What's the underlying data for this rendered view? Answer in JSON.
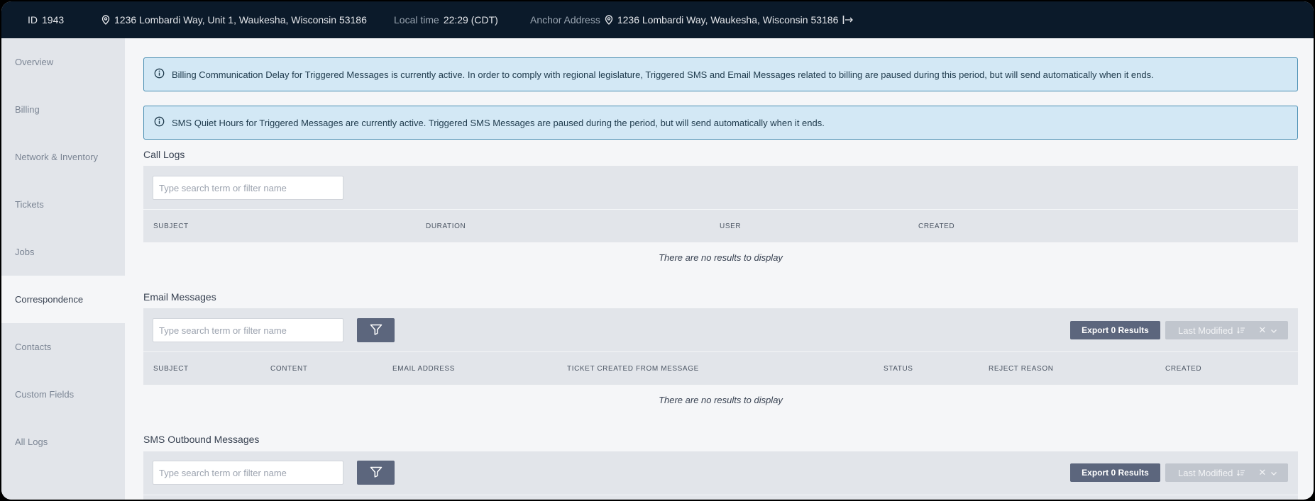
{
  "topbar": {
    "id_label": "ID",
    "id_value": "1943",
    "address": "1236 Lombardi Way, Unit 1, Waukesha, Wisconsin 53186",
    "local_time_label": "Local time",
    "local_time_value": "22:29 (CDT)",
    "anchor_label": "Anchor Address",
    "anchor_address": "1236 Lombardi Way, Waukesha, Wisconsin 53186"
  },
  "sidebar": {
    "items": [
      {
        "label": "Overview"
      },
      {
        "label": "Billing"
      },
      {
        "label": "Network & Inventory"
      },
      {
        "label": "Tickets"
      },
      {
        "label": "Jobs"
      },
      {
        "label": "Correspondence",
        "active": true
      },
      {
        "label": "Contacts"
      },
      {
        "label": "Custom Fields"
      },
      {
        "label": "All Logs"
      }
    ]
  },
  "alerts": [
    {
      "text": "Billing Communication Delay for Triggered Messages is currently active. In order to comply with regional legislature, Triggered SMS and Email Messages related to billing are paused during this period, but will send automatically when it ends."
    },
    {
      "text": "SMS Quiet Hours for Triggered Messages are currently active. Triggered SMS Messages are paused during the period, but will send automatically when it ends."
    }
  ],
  "call_logs": {
    "title": "Call Logs",
    "search_placeholder": "Type search term or filter name",
    "columns": [
      "SUBJECT",
      "DURATION",
      "USER",
      "CREATED"
    ],
    "empty_text": "There are no results to display"
  },
  "email_messages": {
    "title": "Email Messages",
    "search_placeholder": "Type search term or filter name",
    "export_label": "Export 0 Results",
    "sort_label": "Last Modified",
    "columns": [
      "SUBJECT",
      "CONTENT",
      "EMAIL ADDRESS",
      "TICKET CREATED FROM MESSAGE",
      "STATUS",
      "REJECT REASON",
      "CREATED"
    ],
    "empty_text": "There are no results to display"
  },
  "sms_outbound": {
    "title": "SMS Outbound Messages",
    "search_placeholder": "Type search term or filter name",
    "export_label": "Export 0 Results",
    "sort_label": "Last Modified"
  },
  "colors": {
    "topbar_bg": "#0b1a2a",
    "alert_bg": "#d3e8f5",
    "alert_border": "#4a8fb3",
    "button_bg": "#5c667d"
  }
}
